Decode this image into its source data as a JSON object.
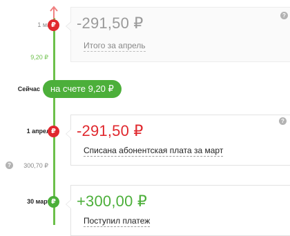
{
  "timeline": [
    {
      "date": "1 мая",
      "date_bold": false,
      "dot_symbol": "₽",
      "dot_color": "#e0282e",
      "amount": "-291,50 ₽",
      "amount_style": "neg-faded",
      "description": "Итого за апрель",
      "faded": true
    },
    {
      "date": "1 апреля",
      "date_bold": true,
      "dot_symbol": "₽",
      "dot_color": "#e0282e",
      "amount": "-291,50 ₽",
      "amount_style": "neg",
      "description": "Списана абонентская плата за март",
      "faded": false
    },
    {
      "date": "30 марта",
      "date_bold": true,
      "dot_symbol": "₽",
      "dot_color": "#4caf3a",
      "amount": "+300,00 ₽",
      "amount_style": "pos",
      "description": "Поступил платеж",
      "faded": false
    }
  ],
  "balance_between_may_april": "9,20 ₽",
  "now": {
    "label": "Сейчас",
    "balance_text": "на счете 9,20 ₽"
  },
  "balance_between_april_march": "300,70 ₽",
  "help_symbol": "?",
  "colors": {
    "green": "#4caf3a",
    "red": "#e0282e",
    "timeline_line": "#6cc04a"
  },
  "icons": [
    "arrow-up-icon",
    "ruble-icon",
    "help-icon"
  ]
}
